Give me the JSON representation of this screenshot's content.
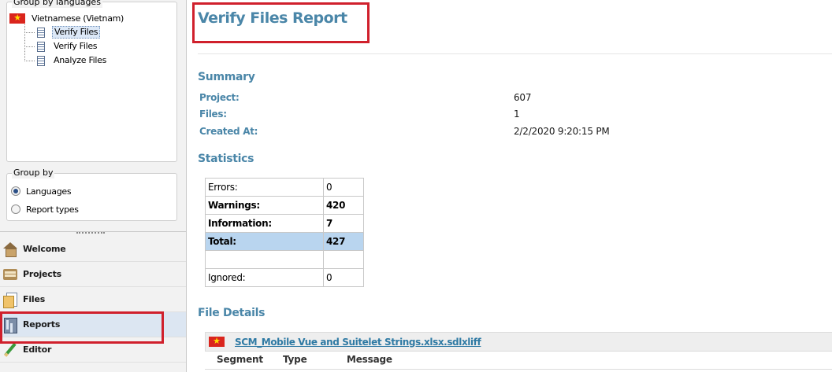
{
  "left_panel": {
    "group_by_languages_legend": "Group by languages",
    "tree": {
      "root_label": "Vietnamese (Vietnam)",
      "items": [
        {
          "label": "Verify Files",
          "selected": true
        },
        {
          "label": "Verify Files",
          "selected": false
        },
        {
          "label": "Analyze Files",
          "selected": false
        }
      ]
    },
    "group_by": {
      "legend": "Group by",
      "options": [
        {
          "label": "Languages",
          "checked": true
        },
        {
          "label": "Report types",
          "checked": false
        }
      ]
    },
    "nav": [
      {
        "label": "Welcome",
        "icon": "home-icon"
      },
      {
        "label": "Projects",
        "icon": "projects-icon"
      },
      {
        "label": "Files",
        "icon": "files-icon"
      },
      {
        "label": "Reports",
        "icon": "reports-icon",
        "active": true
      },
      {
        "label": "Editor",
        "icon": "editor-icon"
      }
    ]
  },
  "report": {
    "title": "Verify Files Report",
    "summary": {
      "heading": "Summary",
      "rows": [
        {
          "label": "Project:",
          "value": "607"
        },
        {
          "label": "Files:",
          "value": "1"
        },
        {
          "label": "Created At:",
          "value": "2/2/2020 9:20:15 PM"
        }
      ]
    },
    "statistics": {
      "heading": "Statistics",
      "rows": [
        {
          "label": "Errors:",
          "value": "0"
        },
        {
          "label": "Warnings:",
          "value": "420"
        },
        {
          "label": "Information:",
          "value": "7"
        },
        {
          "label": "Total:",
          "value": "427"
        },
        {
          "label": "",
          "value": ""
        },
        {
          "label": "Ignored:",
          "value": "0"
        }
      ]
    },
    "file_details": {
      "heading": "File Details",
      "file_name": "SCM_Mobile Vue and Suitelet Strings.xlsx.sdlxliff",
      "columns": [
        "Segment",
        "Type",
        "Message"
      ]
    }
  },
  "colors": {
    "accent_heading": "#4a86a8",
    "highlight_box": "#d0202c",
    "total_row": "#b9d5ef",
    "flag_red": "#da251d",
    "flag_star": "#ffdd00"
  }
}
